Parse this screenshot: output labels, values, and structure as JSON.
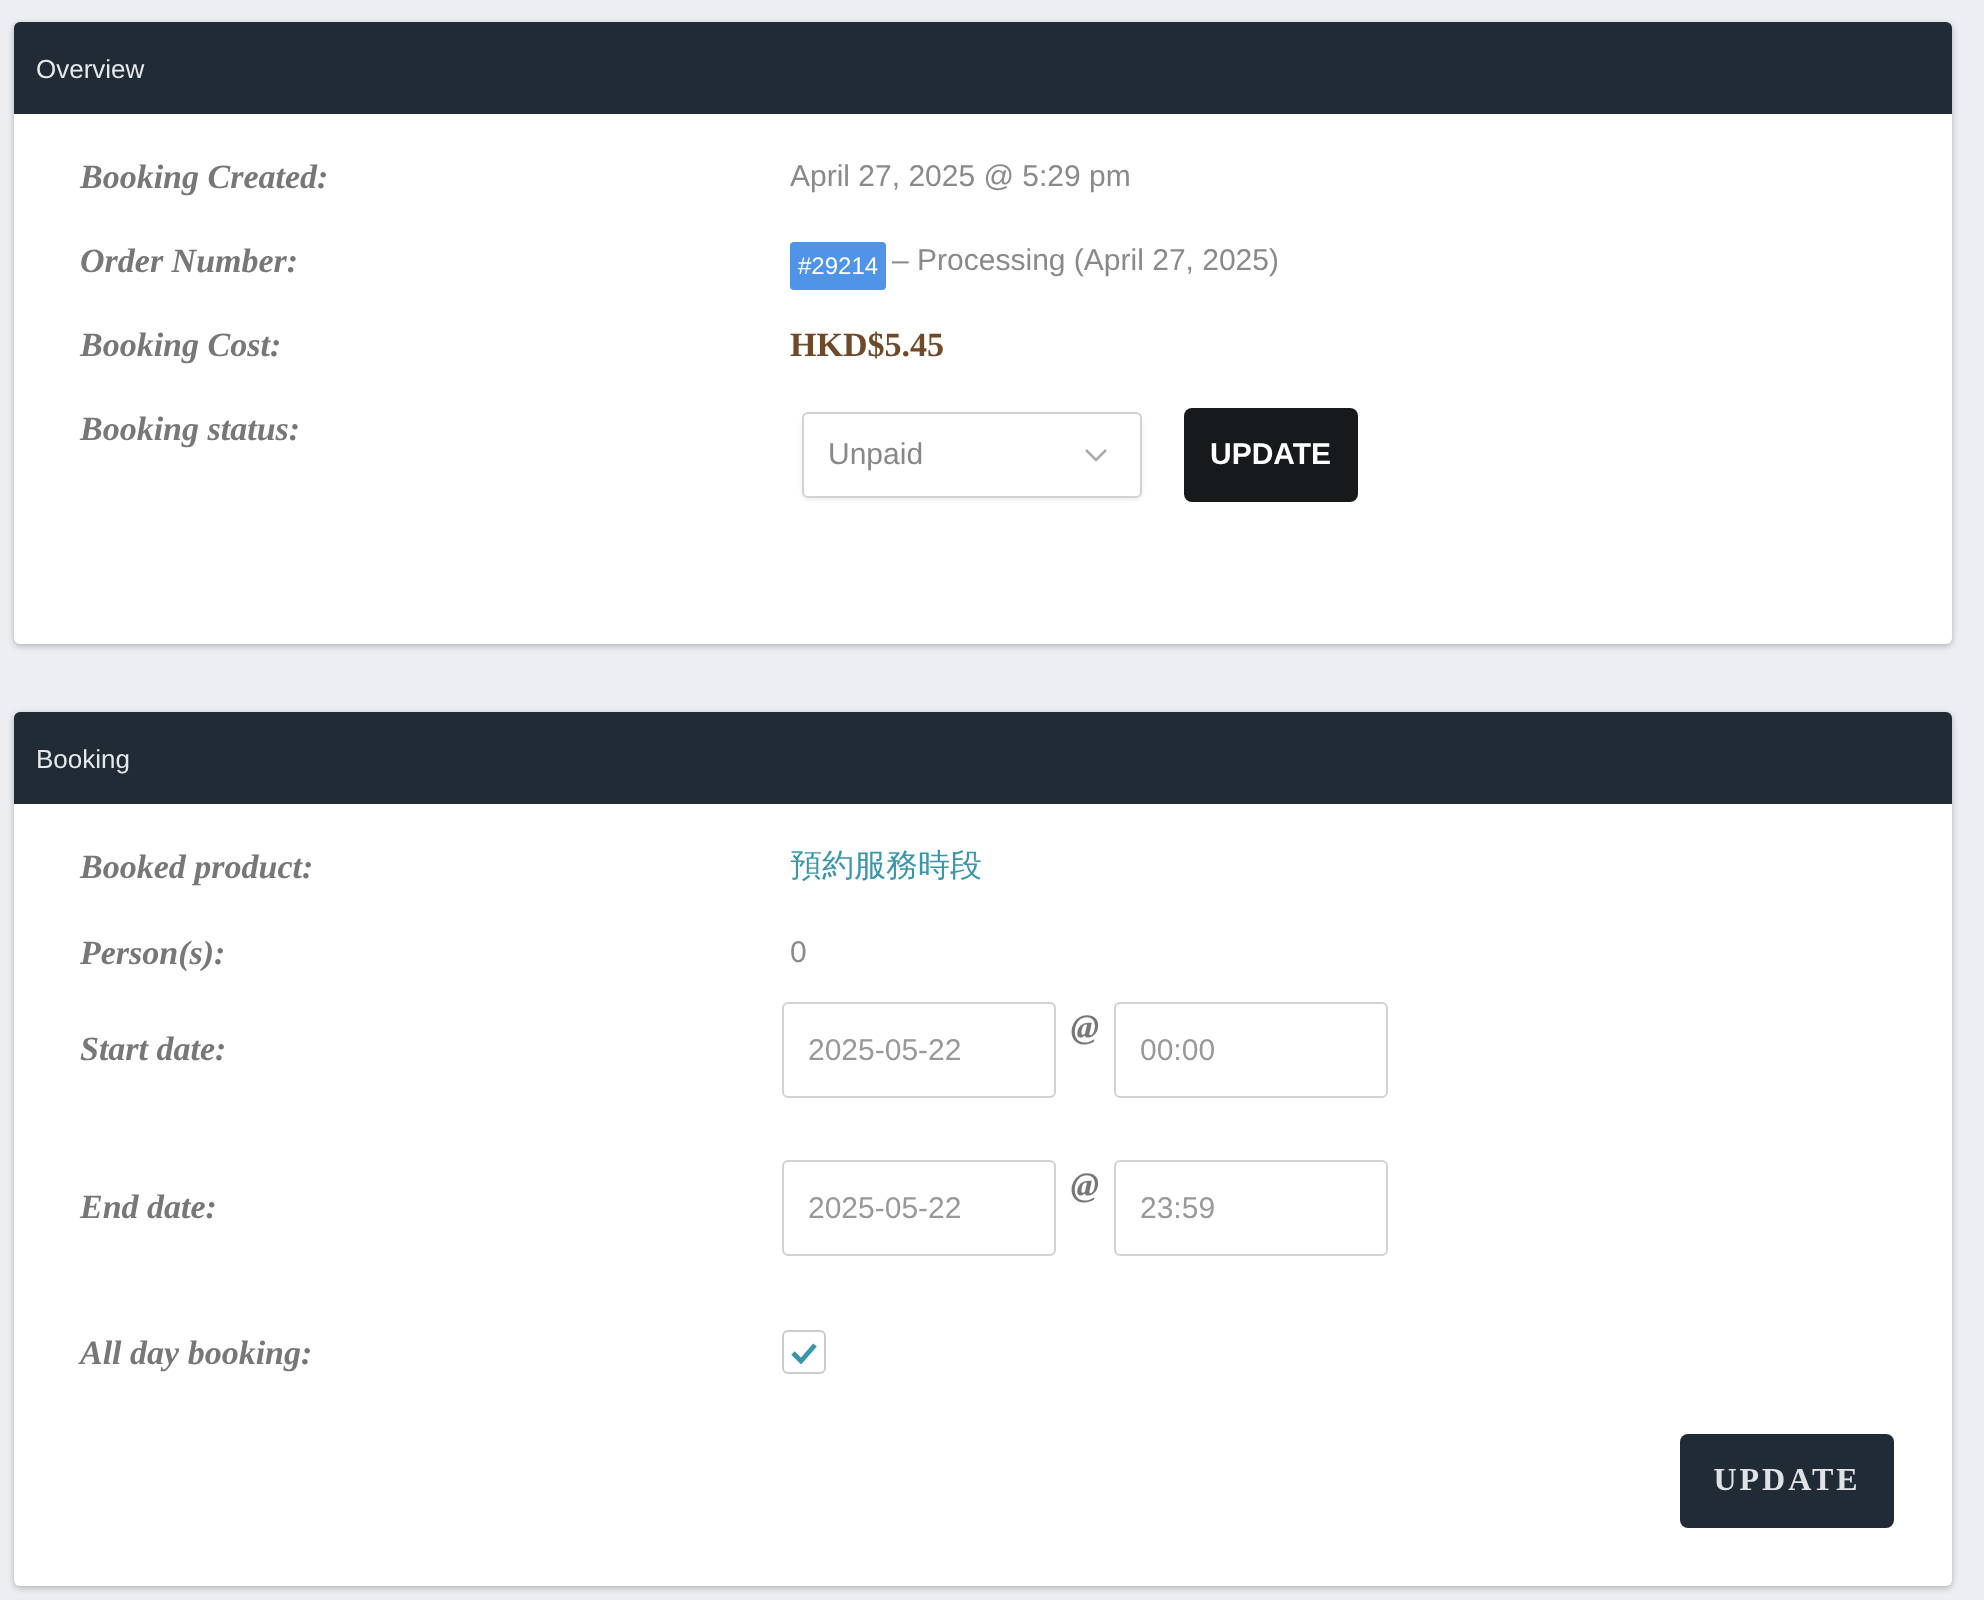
{
  "overview": {
    "title": "Overview",
    "rows": [
      {
        "kind": "text",
        "label": "Booking Created:",
        "value": "April 27, 2025 @ 5:29 pm"
      },
      {
        "kind": "order",
        "label": "Order Number:",
        "badge": "#29214",
        "value": "– Processing (April 27, 2025)"
      },
      {
        "kind": "cost",
        "label": "Booking Cost:",
        "value": "HKD$5.45"
      },
      {
        "kind": "status",
        "label": "Booking status:",
        "select": "Unpaid",
        "button": "UPDATE"
      }
    ]
  },
  "booking": {
    "title": "Booking",
    "rows": [
      {
        "kind": "link",
        "label": "Booked product:",
        "value": "預約服務時段"
      },
      {
        "kind": "text",
        "label": "Person(s):",
        "value": "0"
      },
      {
        "kind": "datetime",
        "label": "Start date:",
        "date": "2025-05-22",
        "at": "@",
        "time": "00:00"
      },
      {
        "kind": "datetime",
        "label": "End date:",
        "date": "2025-05-22",
        "at": "@",
        "time": "23:59"
      },
      {
        "kind": "checkbox",
        "label": "All day booking:",
        "checked": true
      }
    ],
    "button": "UPDATE"
  }
}
